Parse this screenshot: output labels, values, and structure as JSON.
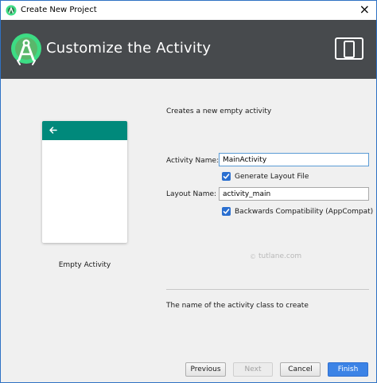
{
  "window": {
    "title": "Create New Project",
    "close_glyph": "×"
  },
  "header": {
    "heading": "Customize the Activity",
    "logo_icon": "android-studio-logo-icon",
    "device_icon": "phone-tablet-icon"
  },
  "preview": {
    "back_icon": "arrow-left-icon",
    "caption": "Empty Activity",
    "appbar_color": "#00897b"
  },
  "form": {
    "description": "Creates a new empty activity",
    "activity_name_label": "Activity Name:",
    "activity_name_value": "MainActivity",
    "generate_layout_label": "Generate Layout File",
    "generate_layout_checked": true,
    "layout_name_label": "Layout Name:",
    "layout_name_value": "activity_main",
    "backwards_compat_label": "Backwards Compatibility (AppCompat)",
    "backwards_compat_checked": true,
    "hint": "The name of the activity class to create"
  },
  "watermark": {
    "text": "tutlane.com"
  },
  "buttons": {
    "previous": "Previous",
    "next": "Next",
    "cancel": "Cancel",
    "finish": "Finish"
  },
  "colors": {
    "header_bg": "#474a4d",
    "accent": "#3c83e6",
    "checkbox": "#2a6fd0"
  }
}
